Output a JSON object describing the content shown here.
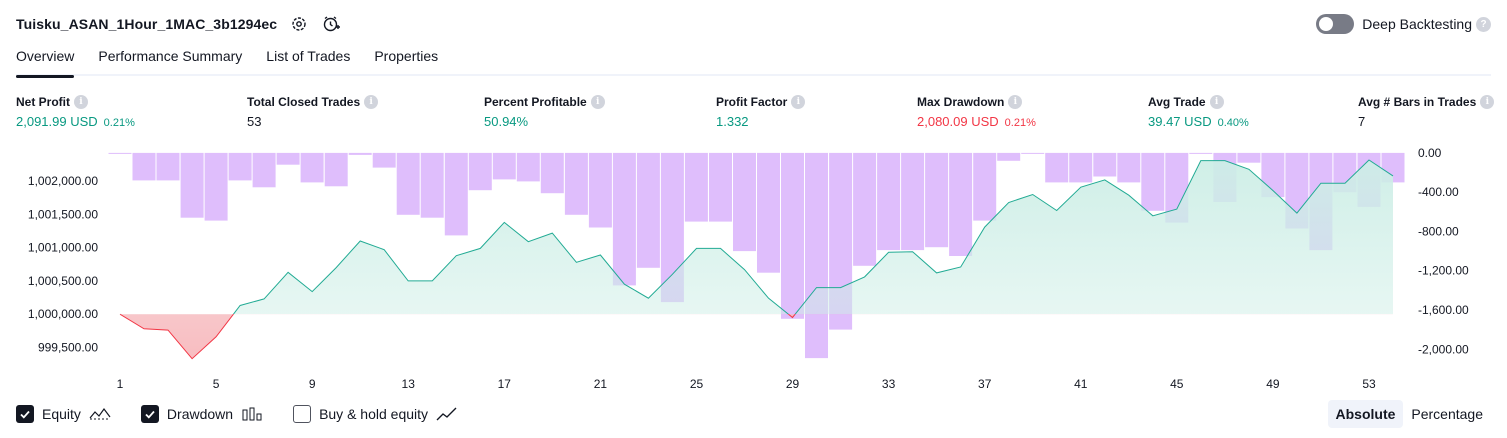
{
  "header": {
    "strategy_name": "Tuisku_ASAN_1Hour_1MAC_3b1294ec",
    "deep_label": "Deep Backtesting",
    "help_glyph": "?"
  },
  "tabs": [
    {
      "label": "Overview",
      "active": true
    },
    {
      "label": "Performance Summary",
      "active": false
    },
    {
      "label": "List of Trades",
      "active": false
    },
    {
      "label": "Properties",
      "active": false
    }
  ],
  "metrics": [
    {
      "label": "Net Profit",
      "value": "2,091.99 USD",
      "pct": "0.21%",
      "tone": "pos"
    },
    {
      "label": "Total Closed Trades",
      "value": "53",
      "pct": "",
      "tone": "neu"
    },
    {
      "label": "Percent Profitable",
      "value": "50.94%",
      "pct": "",
      "tone": "pos"
    },
    {
      "label": "Profit Factor",
      "value": "1.332",
      "pct": "",
      "tone": "pos"
    },
    {
      "label": "Max Drawdown",
      "value": "2,080.09 USD",
      "pct": "0.21%",
      "tone": "neg"
    },
    {
      "label": "Avg Trade",
      "value": "39.47 USD",
      "pct": "0.40%",
      "tone": "pos"
    },
    {
      "label": "Avg # Bars in Trades",
      "value": "7",
      "pct": "",
      "tone": "neu"
    }
  ],
  "info_glyph": "i",
  "legend": {
    "equity": "Equity",
    "drawdown": "Drawdown",
    "buy_hold": "Buy & hold equity"
  },
  "mode": {
    "absolute": "Absolute",
    "percentage": "Percentage"
  },
  "colors": {
    "equity_line": "#22ab94",
    "equity_fill": "#cdeee6",
    "negative_line": "#f23645",
    "negative_fill": "#f7b9bd",
    "drawdown_bar": "#d9b3fc",
    "text": "#131722"
  },
  "chart_data": {
    "type": "area",
    "x": [
      1,
      2,
      3,
      4,
      5,
      6,
      7,
      8,
      9,
      10,
      11,
      12,
      13,
      14,
      15,
      16,
      17,
      18,
      19,
      20,
      21,
      22,
      23,
      24,
      25,
      26,
      27,
      28,
      29,
      30,
      31,
      32,
      33,
      34,
      35,
      36,
      37,
      38,
      39,
      40,
      41,
      42,
      43,
      44,
      45,
      46,
      47,
      48,
      49,
      50,
      51,
      52,
      53,
      54
    ],
    "x_ticks": [
      "1",
      "5",
      "9",
      "13",
      "17",
      "21",
      "25",
      "29",
      "33",
      "37",
      "41",
      "45",
      "49",
      "53"
    ],
    "equity": [
      1000000,
      999780,
      999760,
      999330,
      999660,
      1000130,
      1000230,
      1000630,
      1000340,
      1000700,
      1001100,
      1000970,
      1000500,
      1000500,
      1000880,
      1000990,
      1001380,
      1001090,
      1001220,
      1000780,
      1000890,
      1000450,
      1000240,
      1000600,
      1000990,
      1000990,
      1000670,
      1000240,
      999950,
      1000400,
      1000400,
      1000560,
      1000930,
      1000940,
      1000620,
      1000710,
      1001310,
      1001680,
      1001800,
      1001560,
      1001910,
      1002020,
      1001790,
      1001480,
      1001580,
      1002310,
      1002310,
      1002180,
      1001860,
      1001520,
      1001970,
      1001970,
      1002320,
      1002080
    ],
    "drawdown": [
      0,
      -280,
      -280,
      -660,
      -690,
      -280,
      -350,
      -120,
      -300,
      -340,
      -20,
      -150,
      -630,
      -660,
      -840,
      -380,
      -270,
      -290,
      -410,
      -630,
      -760,
      -1350,
      -1170,
      -1520,
      -700,
      -700,
      -1000,
      -1220,
      -1690,
      -2090,
      -1800,
      -1150,
      -990,
      -990,
      -960,
      -1050,
      -690,
      -80,
      0,
      -300,
      -300,
      -240,
      -300,
      -590,
      -710,
      -1,
      -500,
      -100,
      -450,
      -770,
      -990,
      -400,
      -550,
      -300
    ],
    "ylim_left": [
      999250,
      1002500
    ],
    "ylim_right": [
      -2150,
      50
    ],
    "y_ticks_left": [
      "999,500.00",
      "1,000,000.00",
      "1,000,500.00",
      "1,001,000.00",
      "1,001,500.00",
      "1,002,000.00"
    ],
    "y_ticks_right": [
      "0.00",
      "-400.00",
      "-800.00",
      "-1,200.00",
      "-1,600.00",
      "-2,000.00"
    ],
    "series_names": [
      "Equity",
      "Drawdown"
    ],
    "baseline": 1000000,
    "grid": false
  }
}
